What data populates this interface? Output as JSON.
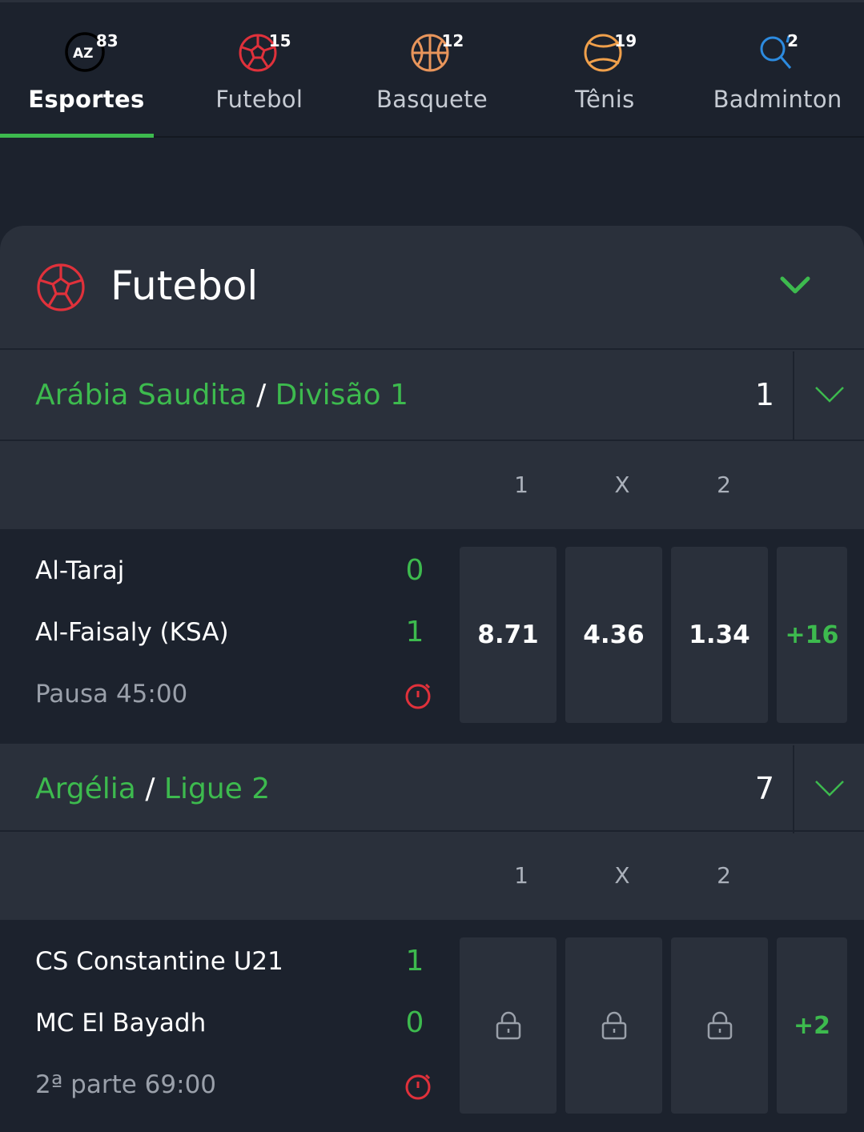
{
  "nav": {
    "tabs": [
      {
        "label": "Esportes",
        "count": "83",
        "icon": "az-icon",
        "active": true
      },
      {
        "label": "Futebol",
        "count": "15",
        "icon": "soccer-ball-icon",
        "active": false
      },
      {
        "label": "Basquete",
        "count": "12",
        "icon": "basketball-icon",
        "active": false
      },
      {
        "label": "Tênis",
        "count": "19",
        "icon": "tennis-ball-icon",
        "active": false
      },
      {
        "label": "Badminton",
        "count": "2",
        "icon": "shuttlecock-icon",
        "active": false
      }
    ],
    "az_text": "AZ"
  },
  "section": {
    "title": "Futebol",
    "icon": "soccer-ball-icon"
  },
  "leagues": [
    {
      "country": "Arábia Saudita",
      "separator": "/",
      "competition": "Divisão 1",
      "count": "1",
      "columns": [
        "1",
        "X",
        "2"
      ],
      "match": {
        "home": "Al-Taraj",
        "away": "Al-Faisaly (KSA)",
        "home_score": "0",
        "away_score": "1",
        "status": "Pausa 45:00",
        "odds": [
          "8.71",
          "4.36",
          "1.34"
        ],
        "more": "+16",
        "locked": false
      }
    },
    {
      "country": "Argélia",
      "separator": "/",
      "competition": "Ligue 2",
      "count": "7",
      "columns": [
        "1",
        "X",
        "2"
      ],
      "match": {
        "home": "CS Constantine U21",
        "away": "MC El Bayadh",
        "home_score": "1",
        "away_score": "0",
        "status": "2ª parte 69:00",
        "odds": [],
        "more": "+2",
        "locked": true
      }
    }
  ],
  "colors": {
    "accent": "#3dba4e",
    "background": "#1c222d",
    "card": "#2a303b",
    "soccer_red": "#e0313b",
    "basketball_orange": "#e8955b",
    "tennis_orange": "#f0a04b",
    "badminton_blue": "#2c8be0"
  }
}
